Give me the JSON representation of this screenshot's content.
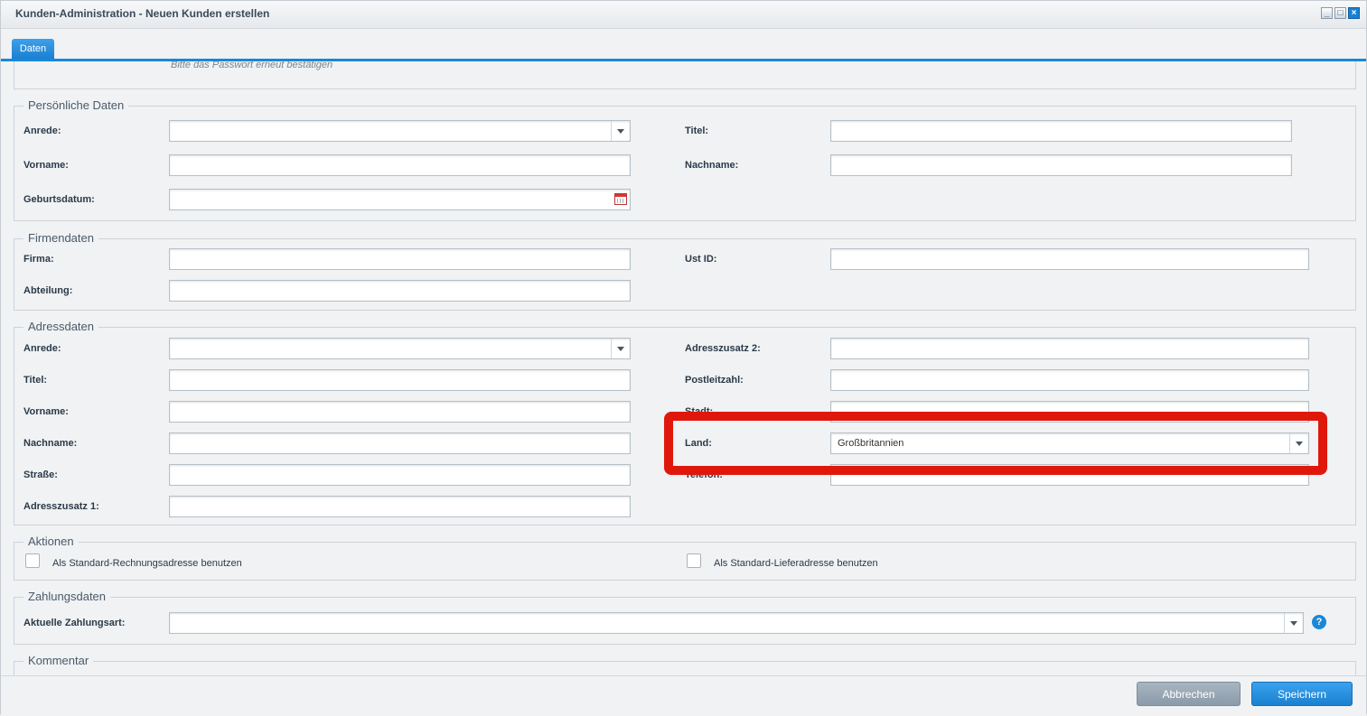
{
  "window": {
    "title": "Kunden-Administration - Neuen Kunden erstellen",
    "controls": {
      "minimize": "_",
      "maximize": "□",
      "close": "×"
    }
  },
  "tabs": [
    {
      "label": "Daten",
      "active": true
    }
  ],
  "top_section": {
    "password_hint": "Bitte das Passwort erneut bestätigen"
  },
  "personal": {
    "legend": "Persönliche Daten",
    "anrede_label": "Anrede:",
    "anrede_value": "",
    "titel_label": "Titel:",
    "titel_value": "",
    "vorname_label": "Vorname:",
    "vorname_value": "",
    "nachname_label": "Nachname:",
    "nachname_value": "",
    "geburtsdatum_label": "Geburtsdatum:",
    "geburtsdatum_value": ""
  },
  "company": {
    "legend": "Firmendaten",
    "firma_label": "Firma:",
    "firma_value": "",
    "ustid_label": "Ust ID:",
    "ustid_value": "",
    "abteilung_label": "Abteilung:",
    "abteilung_value": ""
  },
  "address": {
    "legend": "Adressdaten",
    "anrede_label": "Anrede:",
    "anrede_value": "",
    "titel_label": "Titel:",
    "titel_value": "",
    "vorname_label": "Vorname:",
    "vorname_value": "",
    "nachname_label": "Nachname:",
    "nachname_value": "",
    "strasse_label": "Straße:",
    "strasse_value": "",
    "zusatz1_label": "Adresszusatz 1:",
    "zusatz1_value": "",
    "zusatz2_label": "Adresszusatz 2:",
    "zusatz2_value": "",
    "plz_label": "Postleitzahl:",
    "plz_value": "",
    "stadt_label": "Stadt:",
    "stadt_value": "",
    "land_label": "Land:",
    "land_value": "Großbritannien",
    "telefon_label": "Telefon:",
    "telefon_value": ""
  },
  "actions": {
    "legend": "Aktionen",
    "billing_default": "Als Standard-Rechnungsadresse benutzen",
    "shipping_default": "Als Standard-Lieferadresse benutzen"
  },
  "payment": {
    "legend": "Zahlungsdaten",
    "zahlungsart_label": "Aktuelle Zahlungsart:",
    "zahlungsart_value": "",
    "help": "?"
  },
  "comment": {
    "legend": "Kommentar"
  },
  "footer": {
    "cancel_label": "Abbrechen",
    "save_label": "Speichern"
  },
  "colors": {
    "accent": "#1a87d8",
    "highlight": "#e0180c",
    "cancel": "#97a5b2"
  }
}
